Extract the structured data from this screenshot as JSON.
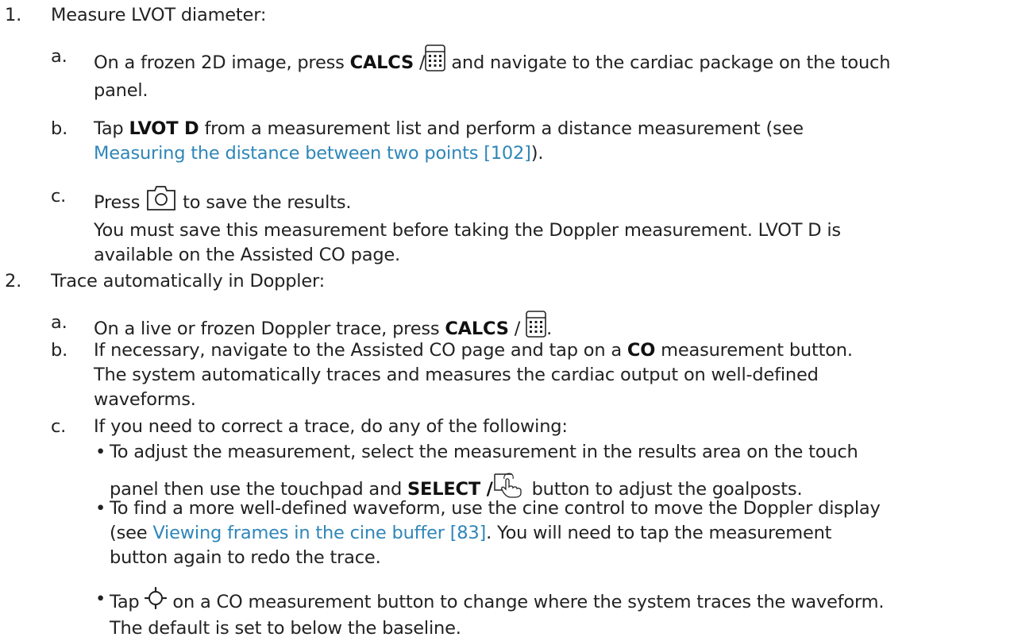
{
  "steps": [
    {
      "number": "1.",
      "title": "Measure LVOT diameter:",
      "substeps": [
        {
          "letter": "a.",
          "pre": "On a frozen 2D image, press ",
          "bold": "CALCS",
          "sep": " /",
          "icon": "calculator-icon",
          "post1": " and navigate to the cardiac package on the touch",
          "post2": "panel."
        },
        {
          "letter": "b.",
          "pre": "Tap ",
          "bold": "LVOT D",
          "post": " from a measurement list and perform a distance measurement (see",
          "link": "Measuring the distance between two points [102]",
          "after_link": ")."
        },
        {
          "letter": "c.",
          "pre": "Press ",
          "icon": "camera-icon",
          "post": " to save the results.",
          "note1": "You must save this measurement before taking the Doppler measurement. LVOT D is",
          "note2": "available on the Assisted CO page."
        }
      ]
    },
    {
      "number": "2.",
      "title": "Trace automatically in Doppler:",
      "substeps": [
        {
          "letter": "a.",
          "pre": "On a live or frozen Doppler trace, press ",
          "bold": "CALCS",
          "sep": " / ",
          "icon": "calculator-icon",
          "post": "."
        },
        {
          "letter": "b.",
          "pre": "If necessary, navigate to the Assisted CO page and tap on a ",
          "bold": "CO",
          "post": " measurement button.",
          "note1": "The system automatically traces and measures the cardiac output on well-defined",
          "note2": "waveforms."
        },
        {
          "letter": "c.",
          "text": "If you need to correct a trace, do any of the following:",
          "bullets": [
            {
              "dot": "•",
              "line1": "To adjust the measurement, select the measurement in the results area on the touch",
              "line2_pre": "panel then use the touchpad and ",
              "line2_bold": "SELECT /",
              "icon": "hand-pointer-icon",
              "line2_post": " button to adjust the goalposts."
            },
            {
              "dot": "•",
              "line1": "To find a more well-defined waveform, use the cine control to move the Doppler display",
              "line2_pre": "(see ",
              "link": "Viewing frames in the cine buffer [83]",
              "line2_post": ". You will need to tap the measurement",
              "line3": "button again to redo the trace."
            },
            {
              "dot": "•",
              "pre": "Tap ",
              "icon": "sun-icon",
              "line1": " on a CO measurement button to change where the system traces the waveform.",
              "line2": "The default is set to below the baseline."
            }
          ]
        }
      ]
    }
  ]
}
